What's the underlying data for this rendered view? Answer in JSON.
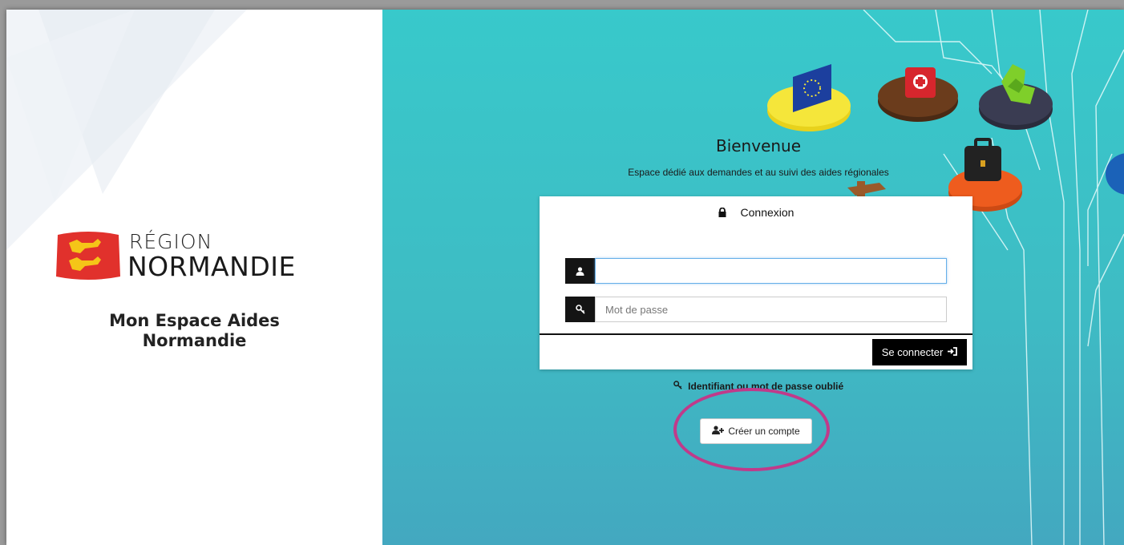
{
  "brand": {
    "region_label": "RÉGION",
    "region_name": "NORMANDIE"
  },
  "app": {
    "name_line1": "Mon Espace Aides",
    "name_line2": "Normandie"
  },
  "hero": {
    "title": "Bienvenue",
    "subtitle": "Espace dédié aux demandes et au suivi des aides régionales"
  },
  "login": {
    "heading": "Connexion",
    "username": {
      "value": "",
      "placeholder": ""
    },
    "password": {
      "value": "",
      "placeholder": "Mot de passe"
    },
    "submit_label": "Se connecter",
    "forgot_label": "Identifiant ou mot de passe oublié",
    "create_label": "Créer un compte"
  },
  "colors": {
    "panel_bg": "#38c9cb",
    "button_dark": "#000000",
    "highlight": "#c03a8a"
  },
  "icons": [
    "lock-icon",
    "user-icon",
    "key-icon",
    "sign-in-icon",
    "user-plus-icon"
  ]
}
